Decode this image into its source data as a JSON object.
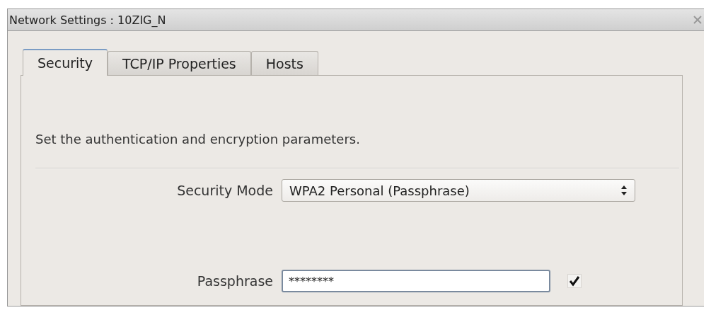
{
  "window": {
    "title": "Network Settings : 10ZIG_N"
  },
  "tabs": [
    {
      "label": "Security",
      "selected": true
    },
    {
      "label": "TCP/IP Properties",
      "selected": false
    },
    {
      "label": "Hosts",
      "selected": false
    }
  ],
  "description": "Set the authentication and encryption parameters.",
  "security_mode": {
    "label": "Security Mode",
    "value": "WPA2 Personal (Passphrase)"
  },
  "passphrase": {
    "label": "Passphrase",
    "value": "********",
    "show_checked": true
  }
}
